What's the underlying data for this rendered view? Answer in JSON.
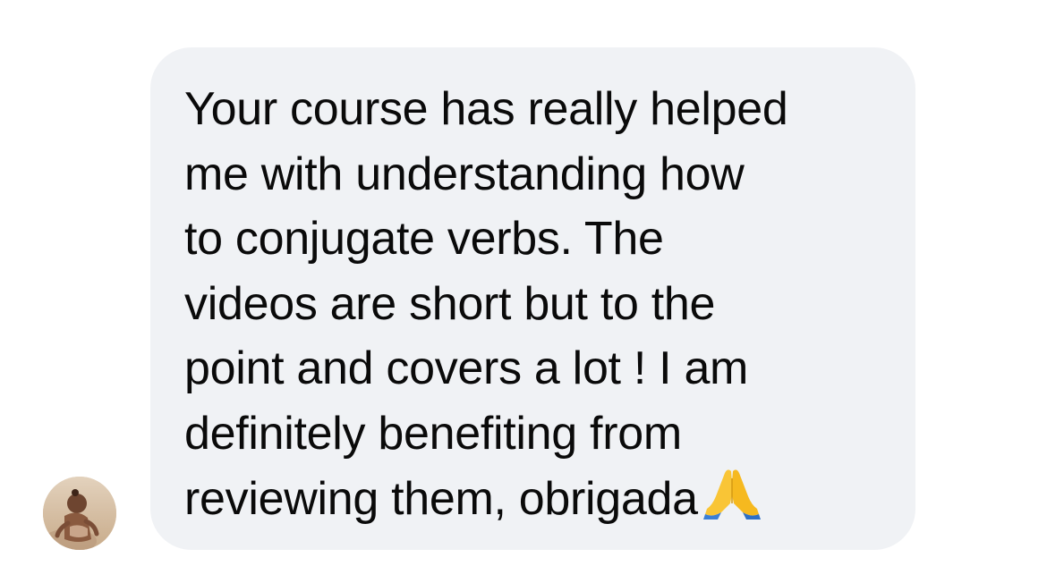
{
  "message": {
    "text": "Your course has really helped\nme with understanding how\nto conjugate verbs. The\nvideos are short but to the\npoint and covers a lot ! I am\ndefinitely benefiting from\nreviewing them, obrigada",
    "emoji_icon": "folded-hands-emoji"
  },
  "sender": {
    "avatar_icon": "child-on-beach-photo"
  },
  "colors": {
    "bubble_background": "#f0f2f5",
    "text": "#0a0a0a",
    "page_background": "#ffffff"
  }
}
